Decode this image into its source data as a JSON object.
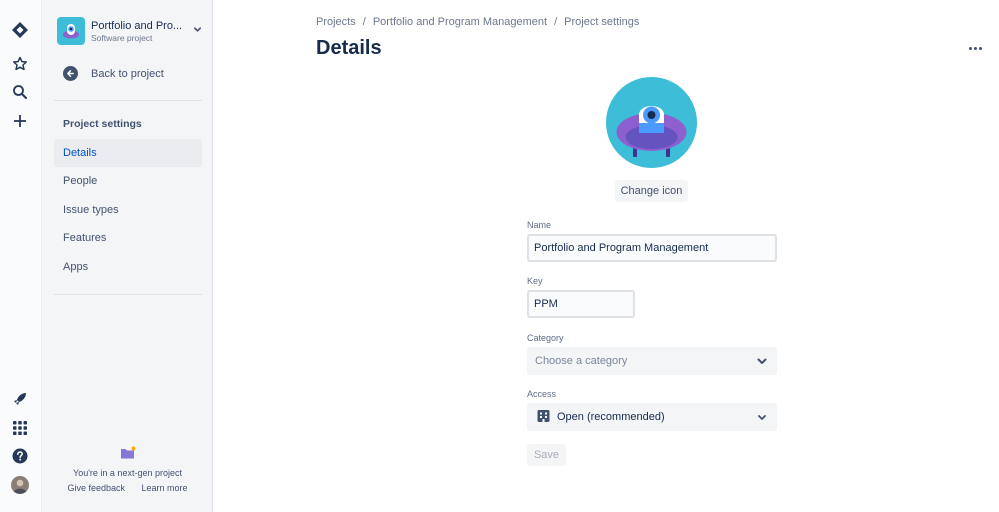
{
  "project": {
    "name": "Portfolio and Pro...",
    "type": "Software project"
  },
  "sidebar": {
    "back_label": "Back to project",
    "section_title": "Project settings",
    "items": [
      {
        "label": "Details",
        "active": true
      },
      {
        "label": "People",
        "active": false
      },
      {
        "label": "Issue types",
        "active": false
      },
      {
        "label": "Features",
        "active": false
      },
      {
        "label": "Apps",
        "active": false
      }
    ],
    "footer": {
      "text": "You're in a next-gen project",
      "feedback": "Give feedback",
      "learn_more": "Learn more"
    }
  },
  "breadcrumb": [
    "Projects",
    "Portfolio and Program Management",
    "Project settings"
  ],
  "breadcrumb_separator": "/",
  "page_title": "Details",
  "change_icon_label": "Change icon",
  "form": {
    "name_label": "Name",
    "name_value": "Portfolio and Program Management",
    "key_label": "Key",
    "key_value": "PPM",
    "category_label": "Category",
    "category_placeholder": "Choose a category",
    "access_label": "Access",
    "access_value": "Open (recommended)",
    "save_label": "Save"
  },
  "colors": {
    "accent": "#0052cc",
    "avatar_bg": "#3dbdd8",
    "avatar_body": "#8e5fcf"
  },
  "icons": {
    "rail": [
      "jira-logo-icon",
      "star-icon",
      "search-icon",
      "plus-icon",
      "rocket-icon",
      "app-switcher-icon",
      "help-icon",
      "user-avatar"
    ]
  }
}
